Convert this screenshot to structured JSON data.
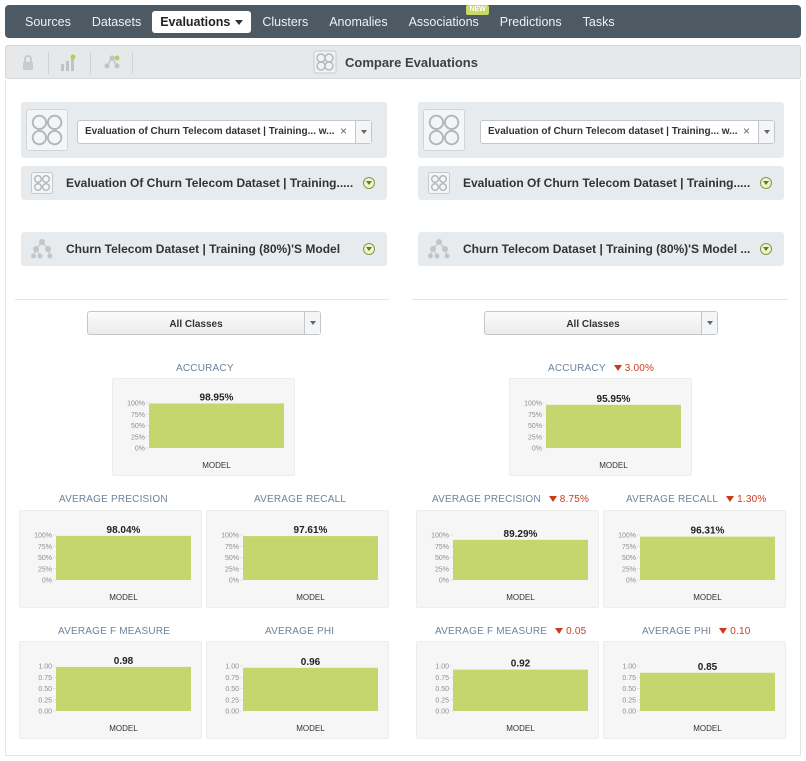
{
  "nav": {
    "items": [
      {
        "label": "Sources"
      },
      {
        "label": "Datasets"
      },
      {
        "label": "Evaluations",
        "active": true
      },
      {
        "label": "Clusters"
      },
      {
        "label": "Anomalies"
      },
      {
        "label": "Associations",
        "badge": "NEW"
      },
      {
        "label": "Predictions"
      },
      {
        "label": "Tasks"
      }
    ]
  },
  "toolbar": {
    "title": "Compare Evaluations",
    "icons": [
      "lock-icon",
      "chart-tree-icon",
      "compare-tree-icon"
    ]
  },
  "left": {
    "evaluation_select": "Evaluation of Churn Telecom dataset | Training... w...",
    "evaluation_name": "Evaluation Of Churn Telecom Dataset | Training.....",
    "model_name": "Churn Telecom Dataset | Training (80%)'S Model",
    "class_select": "All Classes"
  },
  "right": {
    "evaluation_select": "Evaluation of Churn Telecom dataset | Training... w...",
    "evaluation_name": "Evaluation Of Churn Telecom Dataset | Training.....",
    "model_name": "Churn Telecom Dataset | Training (80%)'S Model ...",
    "class_select": "All Classes"
  },
  "labels": {
    "accuracy": "ACCURACY",
    "avg_precision": "AVERAGE PRECISION",
    "avg_recall": "AVERAGE RECALL",
    "avg_f": "AVERAGE F MEASURE",
    "avg_phi": "AVERAGE PHI",
    "model": "MODEL"
  },
  "colors": {
    "bar": "#c6d66f",
    "delta": "#cc3a1e",
    "nav_bg": "#4d5a64"
  },
  "chart_data": [
    {
      "type": "bar",
      "id": "left-accuracy",
      "title": "ACCURACY",
      "categories": [
        "MODEL"
      ],
      "values": [
        98.95
      ],
      "value_label": "98.95%",
      "ylim": [
        0,
        100
      ],
      "ticks": [
        "0%",
        "25%",
        "50%",
        "75%",
        "100%"
      ]
    },
    {
      "type": "bar",
      "id": "left-precision",
      "title": "AVERAGE PRECISION",
      "categories": [
        "MODEL"
      ],
      "values": [
        98.04
      ],
      "value_label": "98.04%",
      "ylim": [
        0,
        100
      ],
      "ticks": [
        "0%",
        "25%",
        "50%",
        "75%",
        "100%"
      ]
    },
    {
      "type": "bar",
      "id": "left-recall",
      "title": "AVERAGE RECALL",
      "categories": [
        "MODEL"
      ],
      "values": [
        97.61
      ],
      "value_label": "97.61%",
      "ylim": [
        0,
        100
      ],
      "ticks": [
        "0%",
        "25%",
        "50%",
        "75%",
        "100%"
      ]
    },
    {
      "type": "bar",
      "id": "left-f",
      "title": "AVERAGE F MEASURE",
      "categories": [
        "MODEL"
      ],
      "values": [
        0.98
      ],
      "value_label": "0.98",
      "ylim": [
        0,
        1
      ],
      "ticks": [
        "0.00",
        "0.25",
        "0.50",
        "0.75",
        "1.00"
      ]
    },
    {
      "type": "bar",
      "id": "left-phi",
      "title": "AVERAGE PHI",
      "categories": [
        "MODEL"
      ],
      "values": [
        0.96
      ],
      "value_label": "0.96",
      "ylim": [
        0,
        1
      ],
      "ticks": [
        "0.00",
        "0.25",
        "0.50",
        "0.75",
        "1.00"
      ]
    },
    {
      "type": "bar",
      "id": "right-accuracy",
      "title": "ACCURACY",
      "delta": "3.00%",
      "categories": [
        "MODEL"
      ],
      "values": [
        95.95
      ],
      "value_label": "95.95%",
      "ylim": [
        0,
        100
      ],
      "ticks": [
        "0%",
        "25%",
        "50%",
        "75%",
        "100%"
      ]
    },
    {
      "type": "bar",
      "id": "right-precision",
      "title": "AVERAGE PRECISION",
      "delta": "8.75%",
      "categories": [
        "MODEL"
      ],
      "values": [
        89.29
      ],
      "value_label": "89.29%",
      "ylim": [
        0,
        100
      ],
      "ticks": [
        "0%",
        "25%",
        "50%",
        "75%",
        "100%"
      ]
    },
    {
      "type": "bar",
      "id": "right-recall",
      "title": "AVERAGE RECALL",
      "delta": "1.30%",
      "categories": [
        "MODEL"
      ],
      "values": [
        96.31
      ],
      "value_label": "96.31%",
      "ylim": [
        0,
        100
      ],
      "ticks": [
        "0%",
        "25%",
        "50%",
        "75%",
        "100%"
      ]
    },
    {
      "type": "bar",
      "id": "right-f",
      "title": "AVERAGE F MEASURE",
      "delta": "0.05",
      "categories": [
        "MODEL"
      ],
      "values": [
        0.92
      ],
      "value_label": "0.92",
      "ylim": [
        0,
        1
      ],
      "ticks": [
        "0.00",
        "0.25",
        "0.50",
        "0.75",
        "1.00"
      ]
    },
    {
      "type": "bar",
      "id": "right-phi",
      "title": "AVERAGE PHI",
      "delta": "0.10",
      "categories": [
        "MODEL"
      ],
      "values": [
        0.85
      ],
      "value_label": "0.85",
      "ylim": [
        0,
        1
      ],
      "ticks": [
        "0.00",
        "0.25",
        "0.50",
        "0.75",
        "1.00"
      ]
    }
  ]
}
